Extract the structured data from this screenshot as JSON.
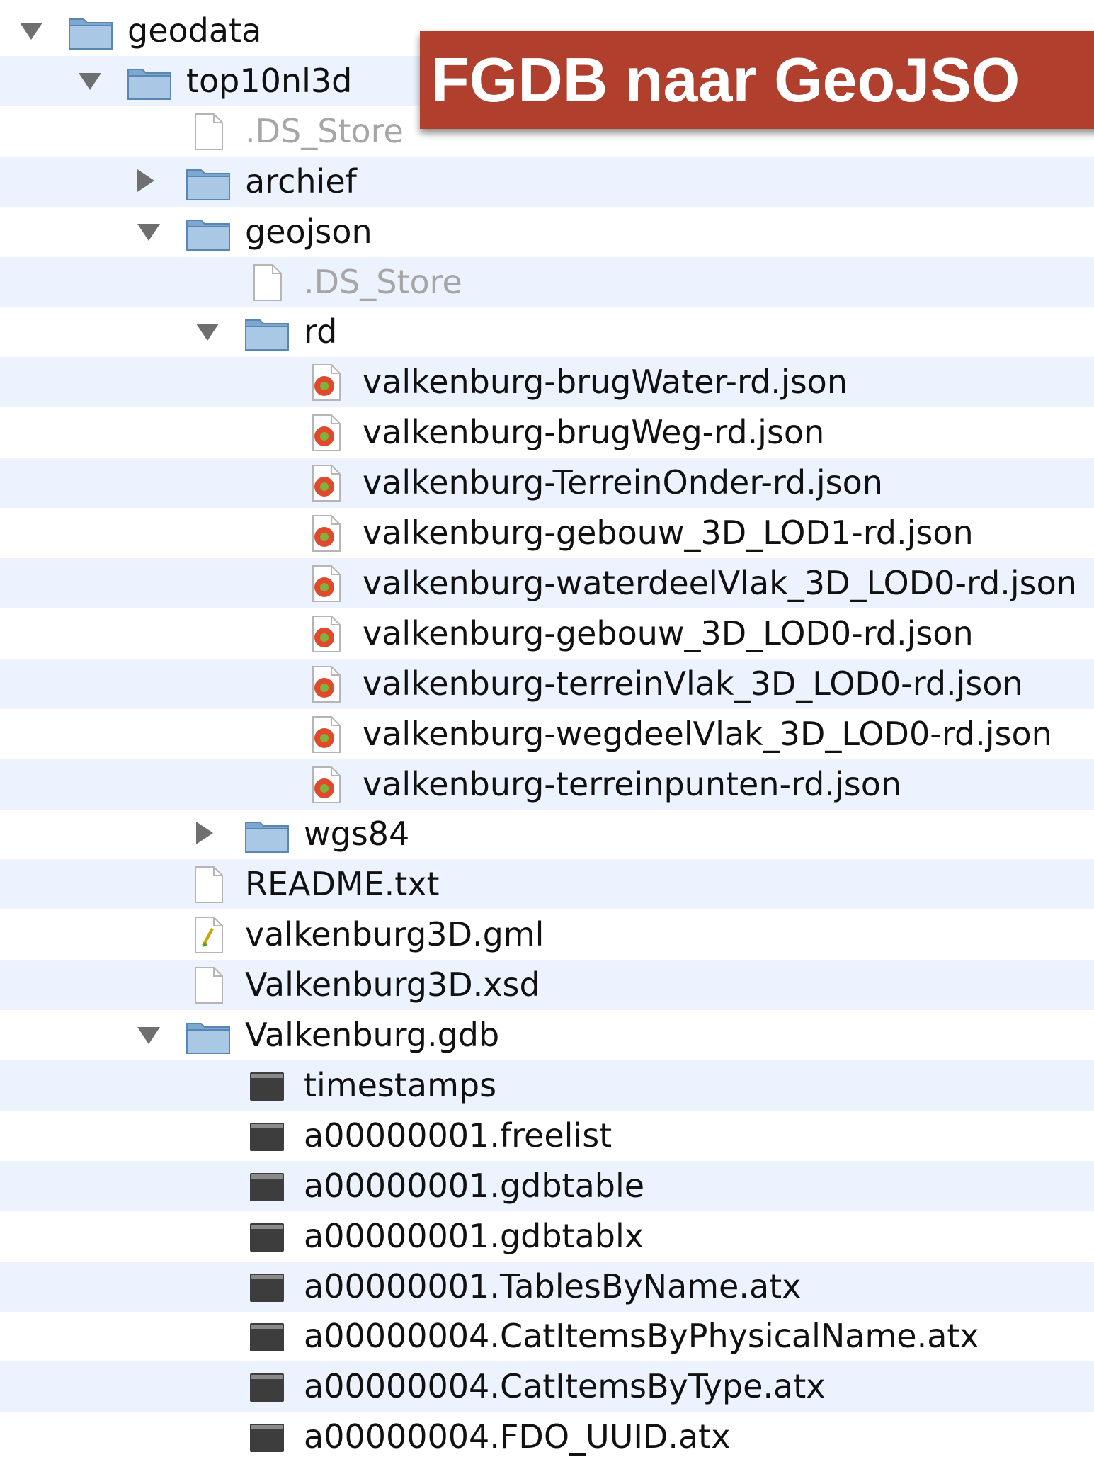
{
  "banner": {
    "text": "FGDB naar GeoJSO"
  },
  "colors": {
    "stripe": "#edf3fe",
    "banner": "#b0402d",
    "folder": "#8fb4d9",
    "json_icon": "#e04a2c"
  },
  "tree": [
    {
      "label": "geodata",
      "depth": 0,
      "type": "folder",
      "disclosure": "open"
    },
    {
      "label": "top10nl3d",
      "depth": 1,
      "type": "folder",
      "disclosure": "open"
    },
    {
      "label": ".DS_Store",
      "depth": 2,
      "type": "file",
      "dim": true
    },
    {
      "label": "archief",
      "depth": 2,
      "type": "folder",
      "disclosure": "closed"
    },
    {
      "label": "geojson",
      "depth": 2,
      "type": "folder",
      "disclosure": "open"
    },
    {
      "label": ".DS_Store",
      "depth": 3,
      "type": "file",
      "dim": true
    },
    {
      "label": "rd",
      "depth": 3,
      "type": "folder",
      "disclosure": "open"
    },
    {
      "label": "valkenburg-brugWater-rd.json",
      "depth": 4,
      "type": "json"
    },
    {
      "label": "valkenburg-brugWeg-rd.json",
      "depth": 4,
      "type": "json"
    },
    {
      "label": "valkenburg-TerreinOnder-rd.json",
      "depth": 4,
      "type": "json"
    },
    {
      "label": "valkenburg-gebouw_3D_LOD1-rd.json",
      "depth": 4,
      "type": "json"
    },
    {
      "label": "valkenburg-waterdeelVlak_3D_LOD0-rd.json",
      "depth": 4,
      "type": "json"
    },
    {
      "label": "valkenburg-gebouw_3D_LOD0-rd.json",
      "depth": 4,
      "type": "json"
    },
    {
      "label": "valkenburg-terreinVlak_3D_LOD0-rd.json",
      "depth": 4,
      "type": "json"
    },
    {
      "label": "valkenburg-wegdeelVlak_3D_LOD0-rd.json",
      "depth": 4,
      "type": "json"
    },
    {
      "label": "valkenburg-terreinpunten-rd.json",
      "depth": 4,
      "type": "json"
    },
    {
      "label": "wgs84",
      "depth": 3,
      "type": "folder",
      "disclosure": "closed"
    },
    {
      "label": "README.txt",
      "depth": 2,
      "type": "file"
    },
    {
      "label": "valkenburg3D.gml",
      "depth": 2,
      "type": "gml"
    },
    {
      "label": "Valkenburg3D.xsd",
      "depth": 2,
      "type": "file"
    },
    {
      "label": "Valkenburg.gdb",
      "depth": 2,
      "type": "folder",
      "disclosure": "open"
    },
    {
      "label": "timestamps",
      "depth": 3,
      "type": "binary"
    },
    {
      "label": "a00000001.freelist",
      "depth": 3,
      "type": "binary"
    },
    {
      "label": "a00000001.gdbtable",
      "depth": 3,
      "type": "binary"
    },
    {
      "label": "a00000001.gdbtablx",
      "depth": 3,
      "type": "binary"
    },
    {
      "label": "a00000001.TablesByName.atx",
      "depth": 3,
      "type": "binary"
    },
    {
      "label": "a00000004.CatItemsByPhysicalName.atx",
      "depth": 3,
      "type": "binary"
    },
    {
      "label": "a00000004.CatItemsByType.atx",
      "depth": 3,
      "type": "binary"
    },
    {
      "label": "a00000004.FDO_UUID.atx",
      "depth": 3,
      "type": "binary"
    }
  ]
}
